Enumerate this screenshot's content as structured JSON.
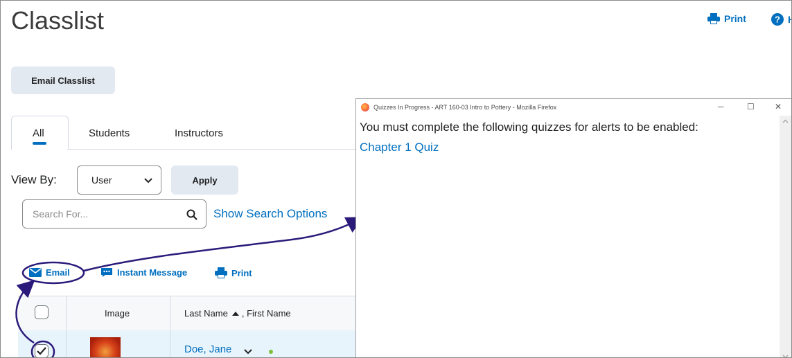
{
  "page": {
    "title": "Classlist",
    "print_label": "Print",
    "help_label": "H",
    "email_classlist_label": "Email Classlist"
  },
  "tabs": [
    {
      "label": "All",
      "active": true
    },
    {
      "label": "Students",
      "active": false
    },
    {
      "label": "Instructors",
      "active": false
    }
  ],
  "filters": {
    "view_by_label": "View By:",
    "view_by_value": "User",
    "apply_label": "Apply",
    "search_placeholder": "Search For...",
    "show_search_options": "Show Search Options"
  },
  "actions": {
    "email": "Email",
    "instant_message": "Instant Message",
    "print": "Print"
  },
  "table": {
    "col_image": "Image",
    "col_name_last": "Last Name",
    "col_name_first": ", First Name",
    "rows": [
      {
        "name": "Doe, Jane",
        "checked": true
      }
    ]
  },
  "popup": {
    "title": "Quizzes In Progress - ART 160-03 Intro to Pottery - Mozilla Firefox",
    "message": "You must complete the following quizzes for alerts to be enabled:",
    "quiz_link": "Chapter 1 Quiz"
  },
  "colors": {
    "link": "#006fbf",
    "annotation": "#2b1a7a",
    "button_bg": "#e3e9f1"
  }
}
